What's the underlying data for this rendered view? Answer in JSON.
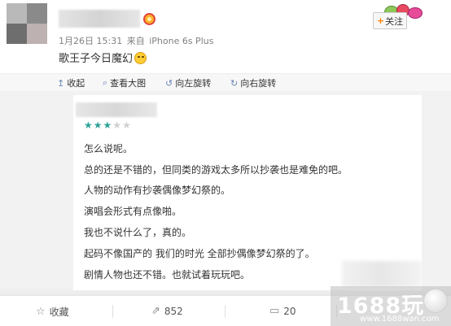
{
  "post": {
    "meta": {
      "date": "1月26日 15:31",
      "from": "来自",
      "device": "iPhone 6s Plus"
    },
    "text": "歌王子今日魔幻",
    "follow_label": "关注",
    "follow_plus": "+"
  },
  "toolbar": {
    "collapse": "收起",
    "view_large": "查看大图",
    "rotate_left": "向左旋转",
    "rotate_right": "向右旋转"
  },
  "review": {
    "rating": {
      "value": 3,
      "max": 5
    },
    "lines": [
      "怎么说呢。",
      "总的还是不错的，但同类的游戏太多所以抄袭也是难免的吧。",
      "人物的动作有抄袭偶像梦幻祭的。",
      "演唱会形式有点像啪。",
      "我也不说什么了，真的。",
      "起码不像国产的 我们的时光 全部抄偶像梦幻祭的了。",
      "剧情人物也还不错。也就试着玩玩吧。"
    ]
  },
  "actions": {
    "favorite": "收藏",
    "repost_count": "852",
    "comment_count": "20"
  },
  "watermark": {
    "logo": "1688玩",
    "url": "www.1688wan.com"
  },
  "colors": {
    "star": "#2ea39a",
    "link_icon": "#6a87b4",
    "follow_plus": "#ff8200"
  }
}
